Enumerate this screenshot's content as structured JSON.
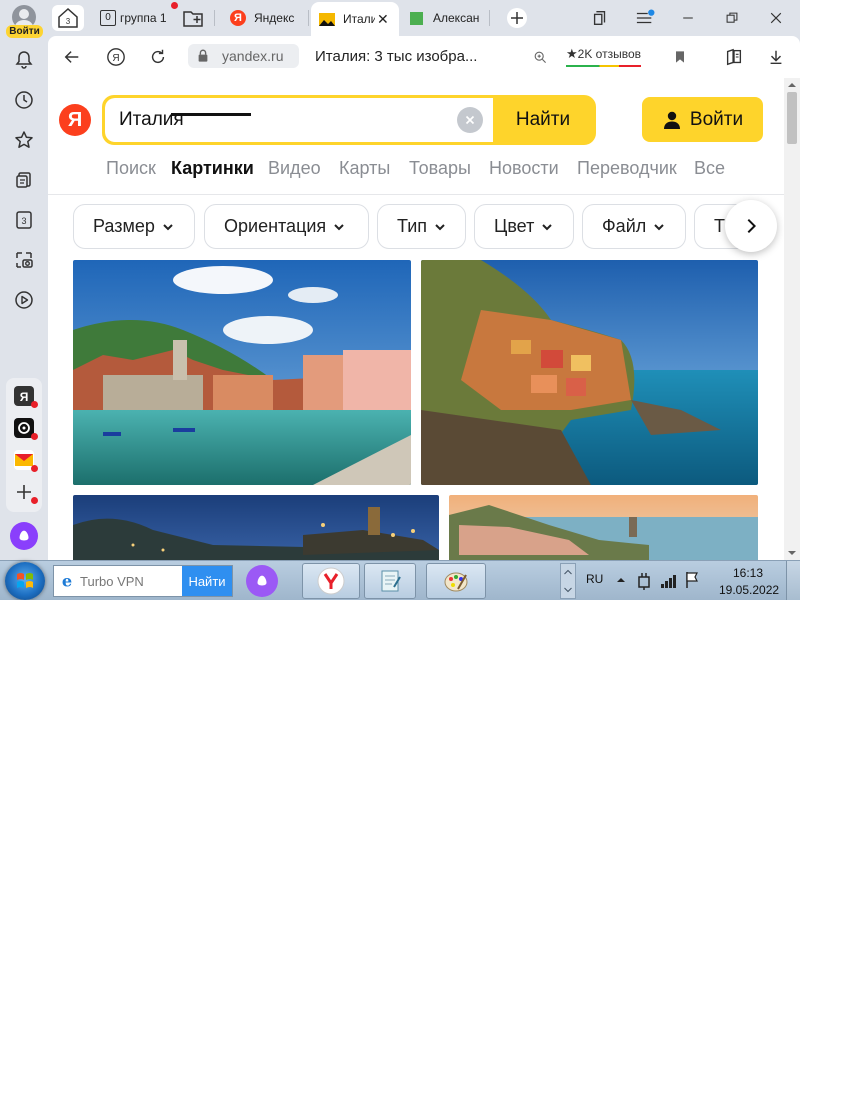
{
  "sidebar": {
    "login_badge": "Войти",
    "counter_label": "3"
  },
  "tabs": {
    "home_count": "3",
    "group_count": "0",
    "group_label": "группа 1",
    "tab_yandex": "Яндекс",
    "tab_italy": "Итали",
    "tab_alex": "Алексан"
  },
  "toolbar": {
    "url_host": "yandex.ru",
    "page_title": "Италия: 3 тыс изобра...",
    "reviews": "2K отзывов"
  },
  "search": {
    "logo": "Я",
    "query": "Италия",
    "button": "Найти",
    "login_button": "Войти"
  },
  "nav": {
    "items": [
      "Поиск",
      "Картинки",
      "Видео",
      "Карты",
      "Товары",
      "Новости",
      "Переводчик",
      "Все"
    ],
    "active": "Картинки"
  },
  "filters": [
    "Размер",
    "Ориентация",
    "Тип",
    "Цвет",
    "Файл",
    "Т"
  ],
  "taskbar": {
    "search_placeholder": "Turbo VPN",
    "search_button": "Найти",
    "language": "RU",
    "time": "16:13",
    "date": "19.05.2022"
  },
  "colors": {
    "accent_yellow": "#fed42b",
    "yandex_red": "#fc3f1d",
    "sidebar_bg": "#dfe3ea"
  }
}
